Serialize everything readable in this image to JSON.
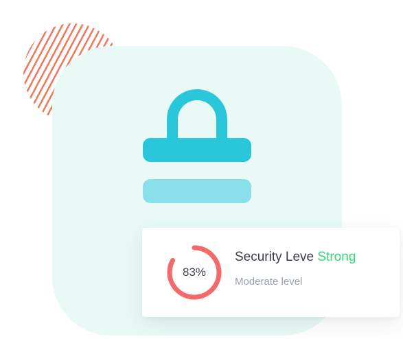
{
  "security": {
    "percent_label": "83%",
    "progress": 0.83,
    "title_prefix": "Security Leve",
    "strength": "Strong",
    "subtitle": "Moderate level"
  },
  "colors": {
    "lock_primary": "#2ac6da",
    "lock_secondary": "#8ae0ea",
    "card_background": "#e9f9f6",
    "progress_ring": "#f36a6a",
    "strength_text": "#33d67a",
    "hatch": "#f0775b"
  },
  "icons": {
    "lock": "lock-icon",
    "progress": "progress-ring"
  }
}
